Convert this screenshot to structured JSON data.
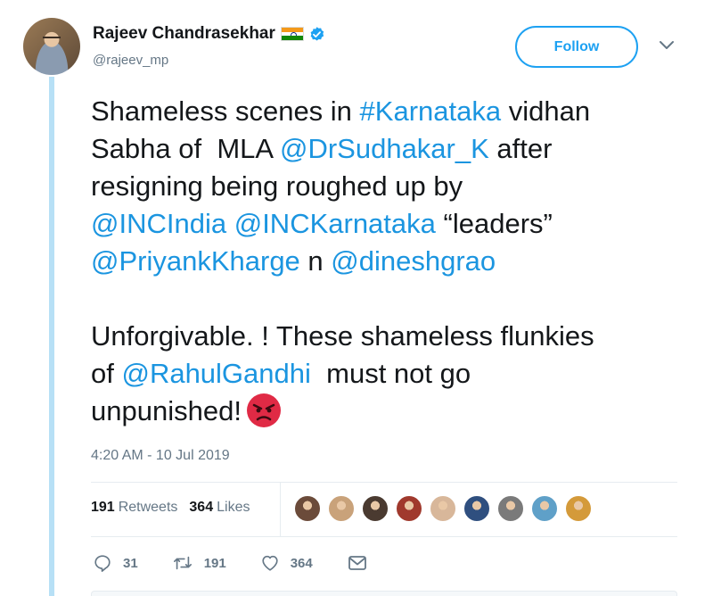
{
  "author": {
    "name": "Rajeev Chandrasekhar",
    "handle": "@rajeev_mp",
    "flag_icon": "india-flag-emoji",
    "verified_icon": "verified-badge-icon"
  },
  "header": {
    "follow_label": "Follow",
    "menu_icon": "chevron-down-icon"
  },
  "tweet": {
    "line1_a": "Shameless scenes in ",
    "line1_link": "#Karnataka",
    "line1_b": " vidhan",
    "line2_a": "Sabha of  MLA ",
    "line2_link": "@DrSudhakar_K",
    "line2_b": " after",
    "line3": "resigning being roughed up by",
    "line4_link1": "@INCIndia",
    "line4_sp": " ",
    "line4_link2": "@INCKarnataka",
    "line4_b": " “leaders”",
    "line5_link1": "@PriyankKharge",
    "line5_mid": " n ",
    "line5_link2": "@dineshgrao",
    "line6": "Unforgivable. ! These shameless flunkies",
    "line7_a": "of ",
    "line7_link": "@RahulGandhi",
    "line7_b": "  must not go",
    "line8": "unpunished!",
    "emoji": "angry-face-emoji"
  },
  "timestamp": "4:20 AM - 10 Jul 2019",
  "stats": {
    "retweets_count": "191",
    "retweets_label": "Retweets",
    "likes_count": "364",
    "likes_label": "Likes"
  },
  "likers": [
    {
      "color": "#6b4b3a"
    },
    {
      "color": "#c9a27a"
    },
    {
      "color": "#4a3a30"
    },
    {
      "color": "#a0392d"
    },
    {
      "color": "#d8b79a"
    },
    {
      "color": "#2f4f7f"
    },
    {
      "color": "#7a7a7a"
    },
    {
      "color": "#5fa0c8"
    },
    {
      "color": "#d49a3a"
    }
  ],
  "actions": {
    "reply_count": "31",
    "retweet_count": "191",
    "like_count": "364"
  },
  "colors": {
    "accent": "#1da1f2",
    "link": "#1b95e0",
    "muted": "#657786",
    "thread_line": "#b7e0f6"
  }
}
